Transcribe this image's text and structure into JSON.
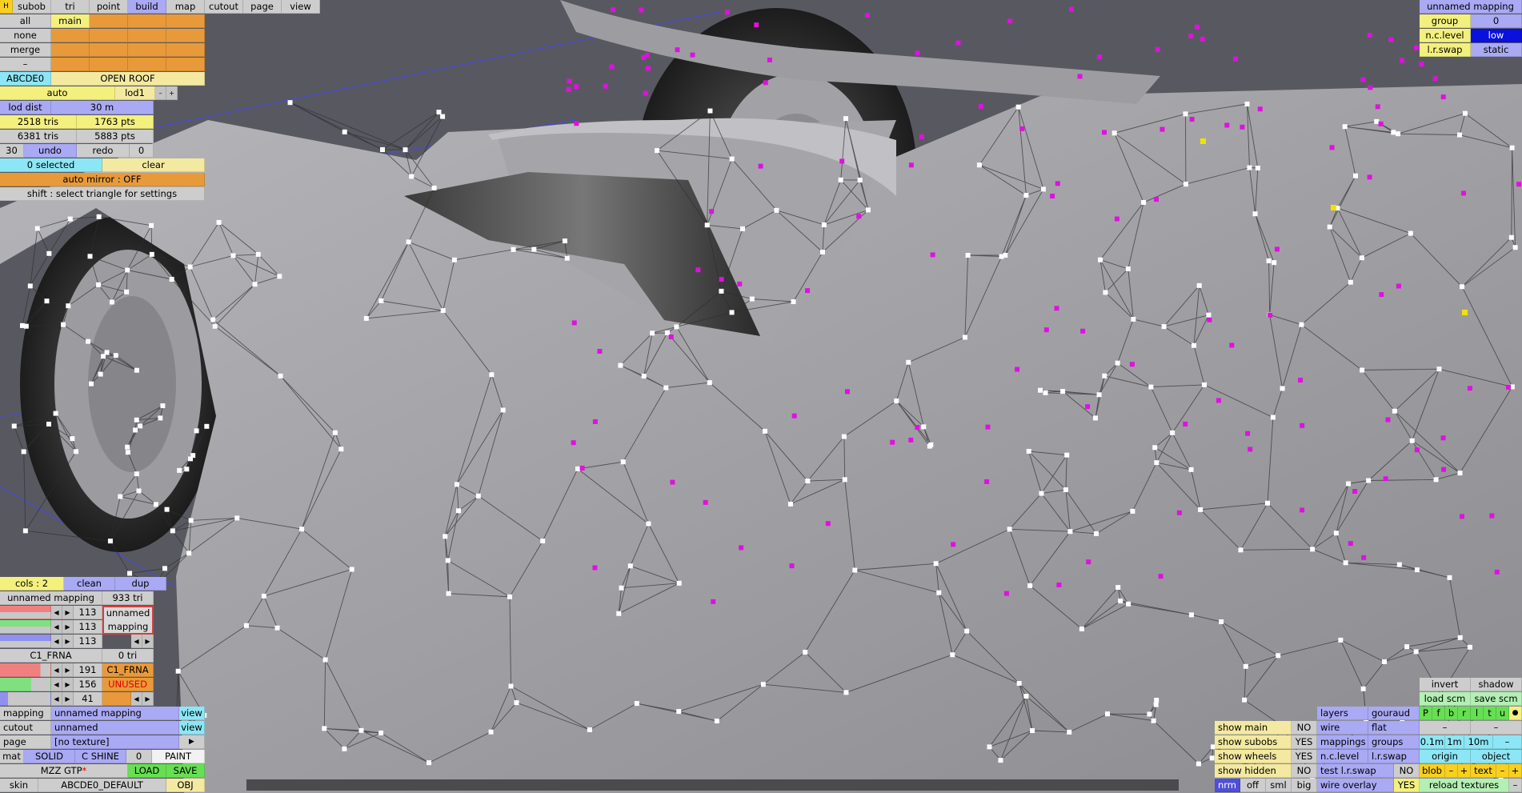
{
  "colors": {
    "viewport_bg": "#585960",
    "body": "#a8a8ac",
    "vertex": "#ffffff",
    "marker": "#e010e0",
    "highlight": "#f2e200",
    "grid": "#4949d8"
  },
  "menu": {
    "icon": "H",
    "tabs": [
      "subob",
      "tri",
      "point",
      "build",
      "map",
      "cutout",
      "page",
      "view"
    ],
    "active": "build"
  },
  "sel_rows": [
    "all",
    "none",
    "merge",
    "–"
  ],
  "main_label": "main",
  "model": {
    "name": "ABCDE0",
    "roof": "OPEN ROOF"
  },
  "lod": {
    "mode": "auto",
    "name": "lod1",
    "minus": "–",
    "plus": "+",
    "dist_label": "lod dist",
    "dist_value": "30 m"
  },
  "stats": {
    "tris_a": "2518 tris",
    "pts_a": "1763 pts",
    "tris_b": "6381 tris",
    "pts_b": "5883 pts"
  },
  "history": {
    "left": "30",
    "undo": "undo",
    "redo": "redo",
    "right": "0"
  },
  "selection": {
    "count": "0 selected",
    "clear": "clear",
    "mirror": "auto mirror : OFF",
    "hint": "shift : select triangle for settings"
  },
  "cols": {
    "label": "cols : 2",
    "clean": "clean",
    "dup": "dup"
  },
  "mapping_group1": {
    "name": "unnamed mapping",
    "tris": "933 tri",
    "counts": [
      "113",
      "113",
      "113"
    ],
    "label": "unnamed mapping"
  },
  "mapping_group2": {
    "name": "C1_FRNA",
    "tris": "0 tri",
    "counts": [
      "191",
      "156",
      "41"
    ],
    "label": "C1_FRNA",
    "status": "UNUSED"
  },
  "props": {
    "mapping": {
      "label": "mapping",
      "value": "unnamed mapping",
      "btn": "view"
    },
    "cutout": {
      "label": "cutout",
      "value": "unnamed",
      "btn": "view"
    },
    "page": {
      "label": "page",
      "value": "[no texture]",
      "btn": "▶"
    },
    "mat": {
      "label": "mat",
      "solid": "SOLID",
      "shine": "C SHINE",
      "num": "0",
      "paint": "PAINT"
    },
    "car": {
      "name": "MZZ GTP",
      "star": "*",
      "load": "LOAD",
      "save": "SAVE"
    },
    "skin": {
      "label": "skin",
      "value": "ABCDE0_DEFAULT",
      "btn": "OBJ"
    }
  },
  "topright": {
    "title": "unnamed mapping",
    "group_label": "group",
    "group_value": "0",
    "nc_label": "n.c.level",
    "nc_value": "low",
    "lr_label": "l.r.swap",
    "lr_value": "static"
  },
  "display": {
    "rows": [
      {
        "label": "show main",
        "value": "NO"
      },
      {
        "label": "show subobs",
        "value": "YES"
      },
      {
        "label": "show wheels",
        "value": "YES"
      },
      {
        "label": "show hidden",
        "value": "NO"
      }
    ],
    "sizes": [
      "nrm",
      "off",
      "sml",
      "big"
    ]
  },
  "render": {
    "layers": "layers",
    "gouraud": "gouraud",
    "wire": "wire",
    "flat": "flat",
    "mappings": "mappings",
    "groups": "groups",
    "nclevel": "n.c.level",
    "lrswap": "l.r.swap",
    "test": "test l.r.swap",
    "test_val": "NO",
    "overlay": "wire overlay",
    "overlay_val": "YES"
  },
  "tools": {
    "invert": "invert",
    "shadow": "shadow",
    "load_scm": "load scm",
    "save_scm": "save scm",
    "flags": [
      "P",
      "f",
      "b",
      "r",
      "l",
      "t",
      "u"
    ],
    "dot": "●",
    "scale": [
      "0.1m",
      "1m",
      "10m",
      "–"
    ],
    "origin": "origin",
    "object": "object",
    "blob": "blob",
    "text": "text",
    "pm": [
      "–",
      "+",
      "–",
      "+"
    ],
    "reload": "reload textures",
    "dash": "–"
  }
}
